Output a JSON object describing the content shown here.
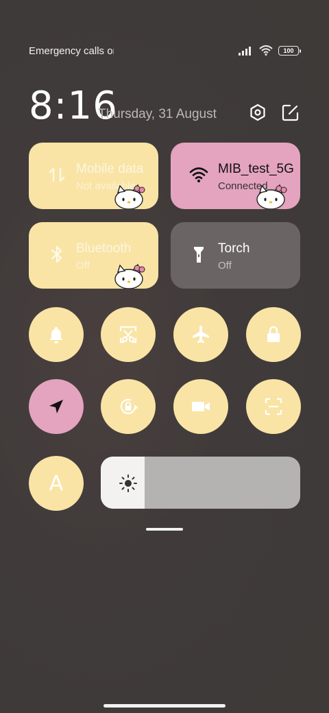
{
  "status_bar": {
    "carrier": "Emergency calls only",
    "battery": "100"
  },
  "header": {
    "time": "8:16",
    "date": "Thursday, 31 August"
  },
  "tiles": {
    "mobile_data": {
      "label": "Mobile data",
      "status": "Not available"
    },
    "wifi": {
      "label": "MIB_test_5G",
      "status": "Connected"
    },
    "bluetooth": {
      "label": "Bluetooth",
      "status": "Off"
    },
    "torch": {
      "label": "Torch",
      "status": "Off"
    }
  },
  "auto_brightness": {
    "letter": "A"
  },
  "brightness": {
    "level_fraction": 0.22
  },
  "colors": {
    "tile_active_yellow": "#f9e4a6",
    "tile_active_pink": "#e4a3bf",
    "tile_inactive": "#6b6464",
    "slider_track": "#b5b3b2",
    "slider_fill": "#f4f2f1"
  },
  "icons": [
    "signal-icon",
    "wifi-icon",
    "battery-icon",
    "settings-icon",
    "edit-icon",
    "mobile-data-icon",
    "bluetooth-icon",
    "torch-icon",
    "bell-icon",
    "screenshot-icon",
    "airplane-icon",
    "lock-icon",
    "location-icon",
    "rotation-lock-icon",
    "video-icon",
    "scan-icon",
    "sun-icon"
  ]
}
